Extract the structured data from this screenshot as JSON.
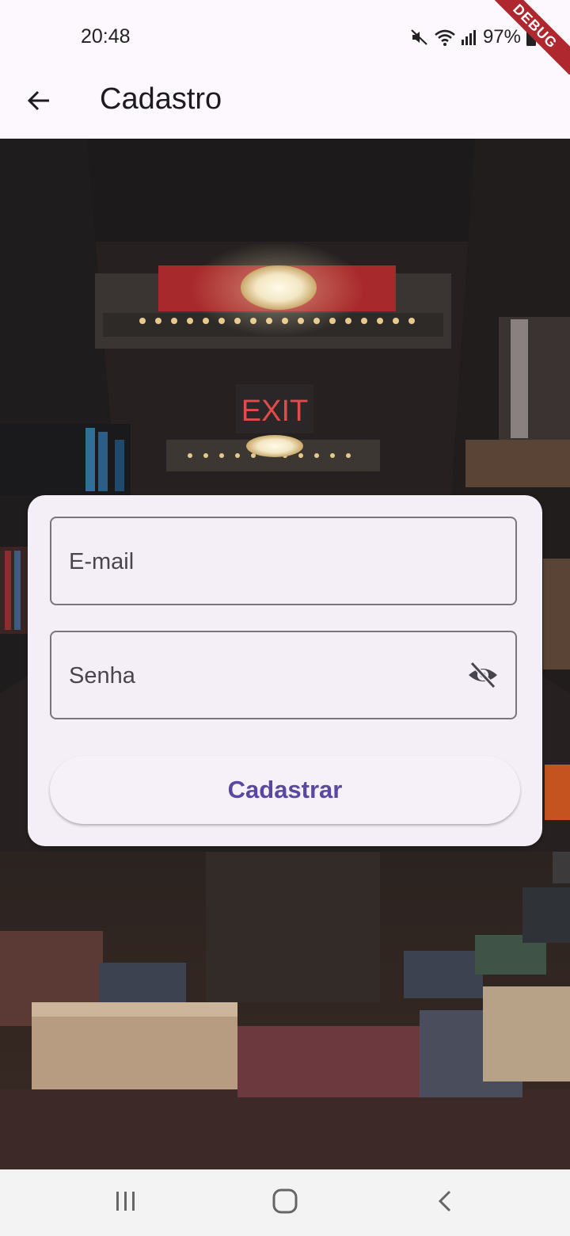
{
  "status_bar": {
    "time": "20:48",
    "battery": "97%",
    "icons": [
      "mute-icon",
      "wifi-icon",
      "signal-icon",
      "battery-icon"
    ],
    "debug_banner": "DEBUG"
  },
  "app_bar": {
    "title": "Cadastro",
    "back_icon": "arrow-back-icon"
  },
  "form": {
    "email": {
      "placeholder": "E-mail",
      "value": ""
    },
    "password": {
      "placeholder": "Senha",
      "value": "",
      "toggle_icon": "visibility-off-icon"
    },
    "submit_label": "Cadastrar"
  },
  "colors": {
    "surface": "#fdf8fd",
    "card": "#f4eff7",
    "primary": "#5a47a0",
    "outline": "#79747e",
    "debug": "#b0282f"
  },
  "nav_bar": {
    "buttons": [
      "recent-apps-icon",
      "home-icon",
      "back-chevron-icon"
    ]
  }
}
